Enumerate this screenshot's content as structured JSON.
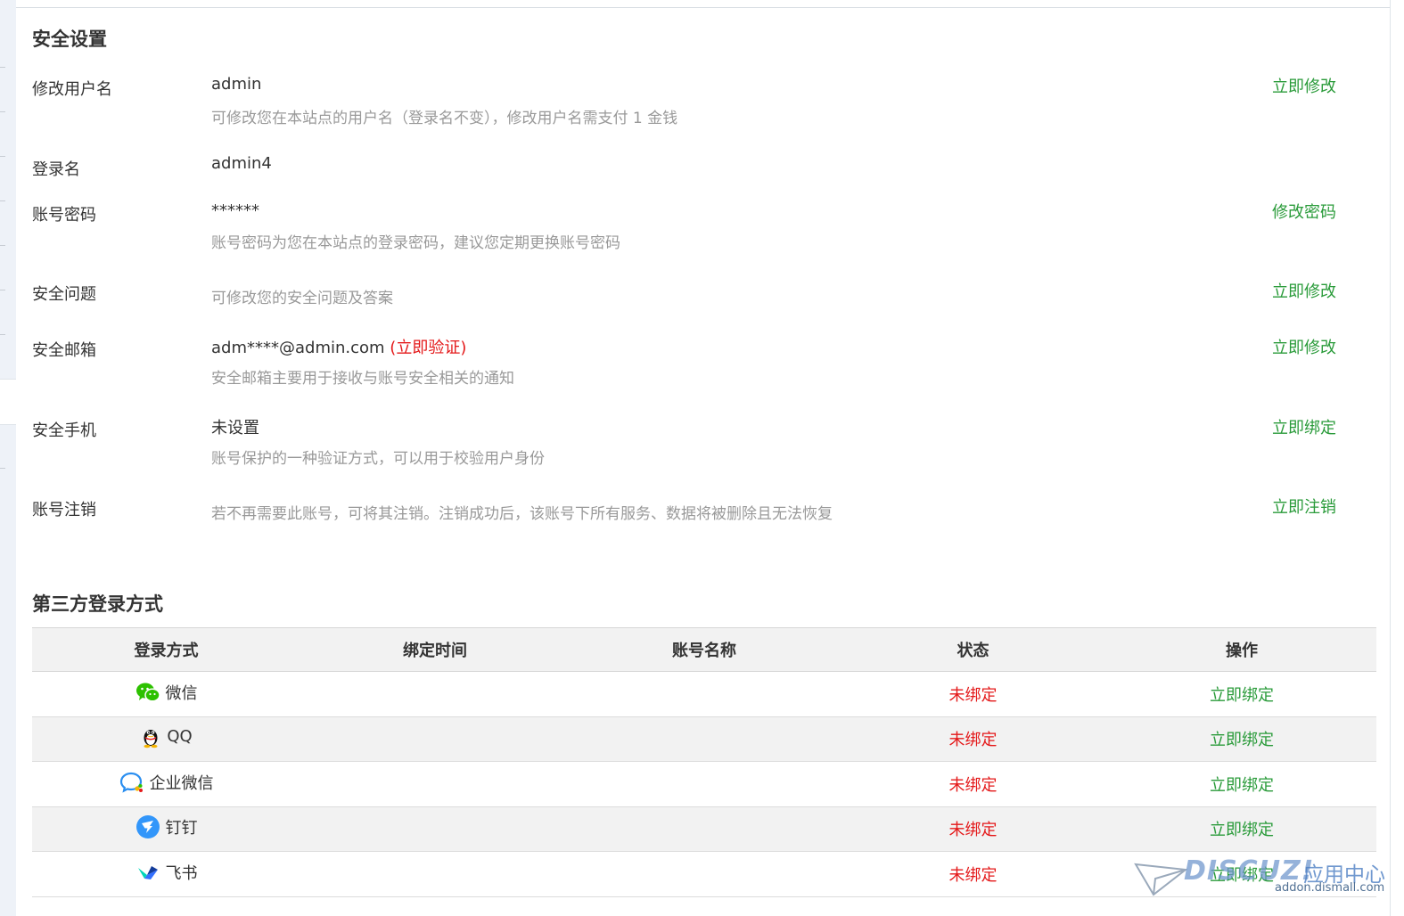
{
  "security": {
    "title": "安全设置",
    "rows": [
      {
        "label": "修改用户名",
        "value": "admin",
        "desc": "可修改您在本站点的用户名（登录名不变），修改用户名需支付 1 金钱",
        "action": "立即修改"
      },
      {
        "label": "登录名",
        "value": "admin4"
      },
      {
        "label": "账号密码",
        "value": "******",
        "desc": "账号密码为您在本站点的登录密码，建议您定期更换账号密码",
        "action": "修改密码"
      },
      {
        "label": "安全问题",
        "desc": "可修改您的安全问题及答案",
        "action": "立即修改"
      },
      {
        "label": "安全邮箱",
        "value": "adm****@admin.com",
        "value_link": "(立即验证)",
        "desc": "安全邮箱主要用于接收与账号安全相关的通知",
        "action": "立即修改"
      },
      {
        "label": "安全手机",
        "value": "未设置",
        "desc": "账号保护的一种验证方式，可以用于校验用户身份",
        "action": "立即绑定"
      },
      {
        "label": "账号注销",
        "desc": "若不再需要此账号，可将其注销。注销成功后，该账号下所有服务、数据将被删除且无法恢复",
        "action": "立即注销"
      }
    ]
  },
  "third_party": {
    "title": "第三方登录方式",
    "columns": [
      "登录方式",
      "绑定时间",
      "账号名称",
      "状态",
      "操作"
    ],
    "rows": [
      {
        "name": "微信",
        "icon": "wechat-icon",
        "time": "",
        "account": "",
        "status": "未绑定",
        "action": "立即绑定"
      },
      {
        "name": "QQ",
        "icon": "qq-icon",
        "time": "",
        "account": "",
        "status": "未绑定",
        "action": "立即绑定"
      },
      {
        "name": "企业微信",
        "icon": "wecom-icon",
        "time": "",
        "account": "",
        "status": "未绑定",
        "action": "立即绑定"
      },
      {
        "name": "钉钉",
        "icon": "dingtalk-icon",
        "time": "",
        "account": "",
        "status": "未绑定",
        "action": "立即绑定"
      },
      {
        "name": "飞书",
        "icon": "feishu-icon",
        "time": "",
        "account": "",
        "status": "未绑定",
        "action": "立即绑定"
      }
    ]
  },
  "watermark": {
    "brand": "DISCUZ!",
    "cn": "应用中心",
    "url": "addon.dismall.com"
  },
  "colors": {
    "action": "#2a9b3a",
    "warning": "#e4191a",
    "muted": "#999999",
    "header_bg": "#f2f2f2"
  }
}
